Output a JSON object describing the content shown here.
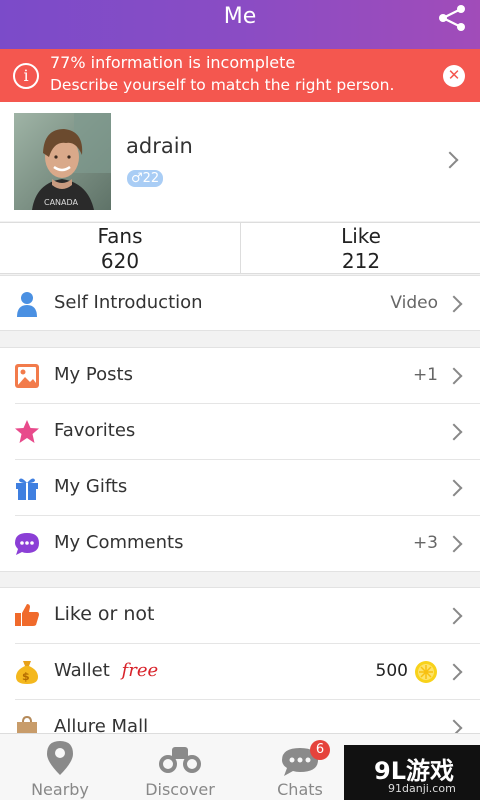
{
  "header": {
    "title": "Me",
    "share_icon": "share-icon"
  },
  "alert": {
    "line1": "77% information is incomplete",
    "line2": "Describe yourself to match the right person.",
    "info_icon": "i",
    "close_icon": "✕"
  },
  "profile": {
    "username": "adrain",
    "gender_badge": "♂22"
  },
  "stats": {
    "fans_label": "Fans",
    "fans_value": "620",
    "like_label": "Like",
    "like_value": "212"
  },
  "intro": {
    "label": "Self Introduction",
    "value": "Video"
  },
  "menu1": [
    {
      "label": "My Posts",
      "value": "+1",
      "icon": "image-icon"
    },
    {
      "label": "Favorites",
      "value": "",
      "icon": "star-icon"
    },
    {
      "label": "My Gifts",
      "value": "",
      "icon": "gift-icon"
    },
    {
      "label": "My Comments",
      "value": "+3",
      "icon": "comment-icon"
    }
  ],
  "menu2": [
    {
      "label": "Like or not",
      "value": "",
      "icon": "thumbs-up-icon"
    },
    {
      "label": "Wallet",
      "tag": "free",
      "value": "500",
      "icon": "money-bag-icon"
    },
    {
      "label": "Allure Mall",
      "value": "",
      "icon": "shopping-bag-icon"
    }
  ],
  "tabs": [
    {
      "label": "Nearby",
      "icon": "location-pin-icon"
    },
    {
      "label": "Discover",
      "icon": "binoculars-icon"
    },
    {
      "label": "Chats",
      "icon": "chat-bubble-icon",
      "badge": "6"
    }
  ],
  "watermark": {
    "logo": "9L游戏",
    "url": "91danji.com"
  },
  "colors": {
    "header": "#8a4cc4",
    "alert": "#f4574f",
    "badge": "#e5433c",
    "gender": "#a9cdf5"
  }
}
